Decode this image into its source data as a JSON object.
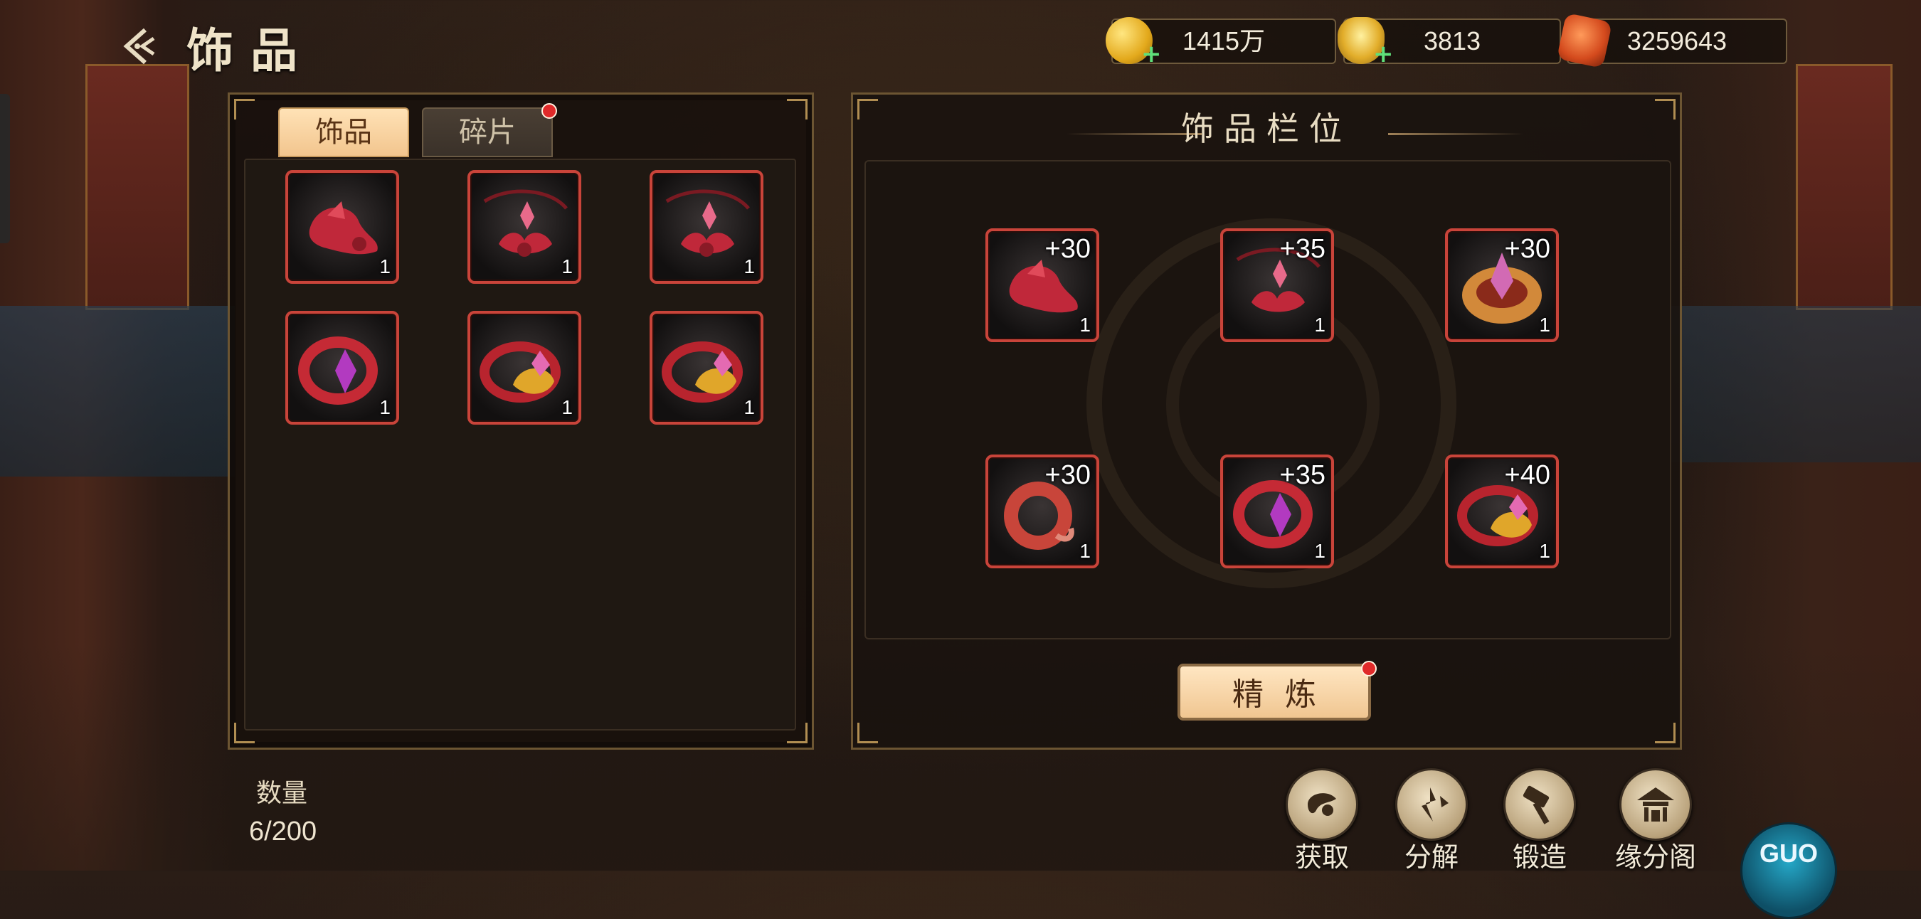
{
  "header": {
    "back_icon": "back-arrow-icon",
    "title": "饰品"
  },
  "currencies": [
    {
      "name": "gold-coin",
      "value": "1415万",
      "icon": "gold-coin-icon"
    },
    {
      "name": "gold-ingot",
      "value": "3813",
      "icon": "gold-ingot-icon"
    },
    {
      "name": "red-gem",
      "value": "3259643",
      "icon": "red-gem-icon"
    }
  ],
  "left_panel": {
    "tabs": [
      {
        "label": "饰品",
        "active": true,
        "badge": false
      },
      {
        "label": "碎片",
        "active": false,
        "badge": true
      }
    ],
    "items": [
      {
        "icon": "red-jade-pendant-icon",
        "qty": "1"
      },
      {
        "icon": "ruby-necklace-icon",
        "qty": "1"
      },
      {
        "icon": "ruby-necklace-icon",
        "qty": "1"
      },
      {
        "icon": "red-crystal-ring-icon",
        "qty": "1"
      },
      {
        "icon": "gold-gem-ring-icon",
        "qty": "1"
      },
      {
        "icon": "gold-gem-ring-icon",
        "qty": "1"
      }
    ]
  },
  "inventory": {
    "qty_label": "数量",
    "qty_value": "6/200"
  },
  "right_panel": {
    "title": "饰品栏位",
    "slots": [
      {
        "icon": "red-jade-pendant-icon",
        "level": "+30",
        "qty": "1"
      },
      {
        "icon": "ruby-necklace-icon",
        "level": "+35",
        "qty": "1"
      },
      {
        "icon": "gold-crown-ornament-icon",
        "level": "+30",
        "qty": "1"
      },
      {
        "icon": "red-bangle-icon",
        "level": "+30",
        "qty": "1"
      },
      {
        "icon": "red-crystal-ring-icon",
        "level": "+35",
        "qty": "1"
      },
      {
        "icon": "gold-gem-ring-icon",
        "level": "+40",
        "qty": "1"
      }
    ],
    "refine_label": "精炼",
    "refine_badge": true
  },
  "actions": [
    {
      "label": "获取",
      "icon": "acquire-icon"
    },
    {
      "label": "分解",
      "icon": "decompose-icon"
    },
    {
      "label": "锻造",
      "icon": "hammer-icon"
    },
    {
      "label": "缘分阁",
      "icon": "pavilion-icon"
    }
  ],
  "logo_text": "GUO",
  "colors": {
    "slot_border": "#c9443a",
    "tab_active": "#f2c58e",
    "badge": "#e02a2a",
    "panel_border": "#6c5532"
  }
}
